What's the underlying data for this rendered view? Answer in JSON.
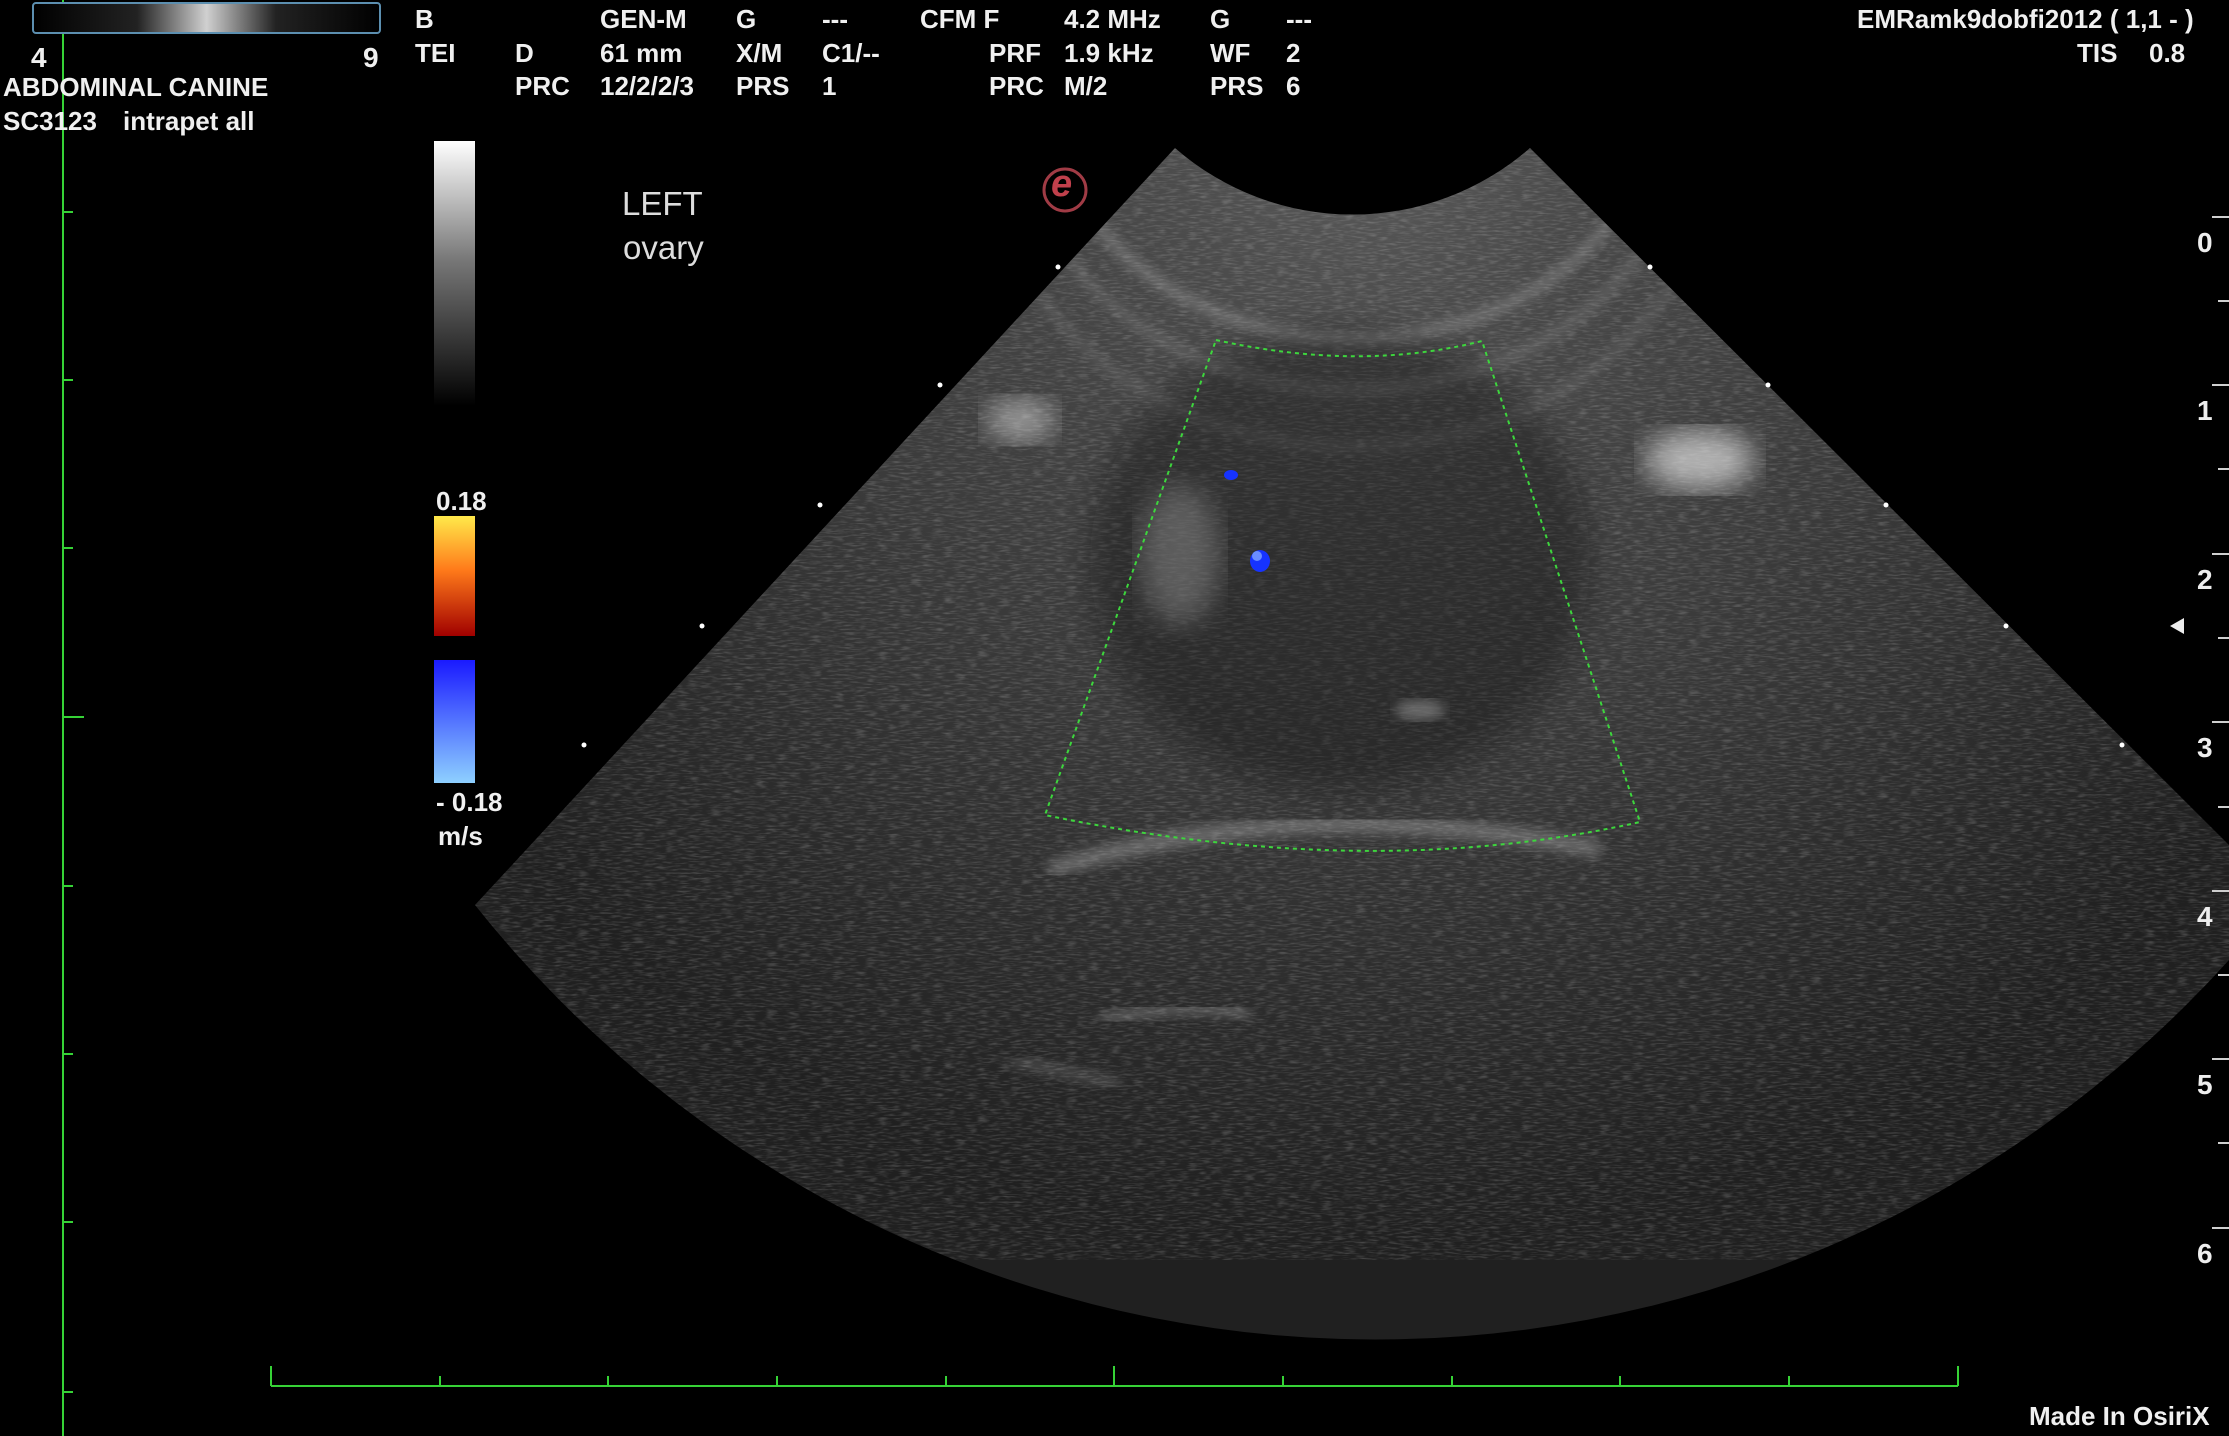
{
  "gray_bar": {
    "min": "4",
    "max": "9"
  },
  "exam": {
    "preset": "ABDOMINAL CANINE",
    "probe": "SC3123",
    "preset_sub": "intrapet all"
  },
  "params": {
    "c1": [
      "B",
      "TEI",
      ""
    ],
    "c2": [
      "",
      "D",
      "PRC"
    ],
    "c3": [
      "GEN-M",
      "61 mm",
      "12/2/2/3"
    ],
    "c4": [
      "G",
      "X/M",
      "PRS"
    ],
    "c5": [
      "---",
      "C1/--",
      "1"
    ],
    "c6": [
      "CFM F",
      "PRF",
      "PRC"
    ],
    "c7": [
      "4.2 MHz",
      "1.9 kHz",
      "M/2"
    ],
    "c8": [
      "G",
      "WF",
      "PRS"
    ],
    "c9": [
      "---",
      "2",
      "6"
    ]
  },
  "top_right": {
    "header": "EMRamk9dobfi2012 ( 1,1 - )",
    "tis_label": "TIS",
    "tis_value": "0.8"
  },
  "color_scale": {
    "max": "0.18",
    "min": "- 0.18",
    "unit": "m/s",
    "positive_colors": [
      "#ffe94a",
      "#ff7a1a",
      "#a00000"
    ],
    "negative_colors": [
      "#1a1aff",
      "#8ed0ff"
    ]
  },
  "annotation": {
    "line1": "LEFT",
    "line2": "ovary"
  },
  "logo": {
    "glyph": "e"
  },
  "depth_scale": {
    "unit_note": "cm",
    "labels": [
      "0",
      "1",
      "2",
      "3",
      "4",
      "5",
      "6"
    ]
  },
  "footer": {
    "credit": "Made In OsiriX"
  },
  "colors": {
    "overlay_green": "#36d236",
    "roi_green": "#3dd63d",
    "doppler_blue": "#1633ff"
  }
}
